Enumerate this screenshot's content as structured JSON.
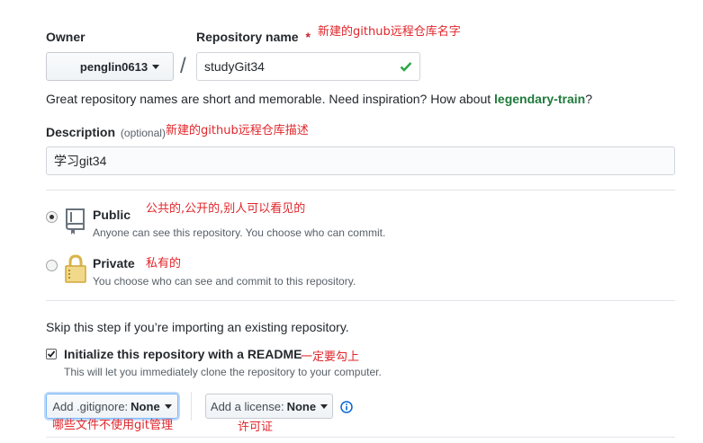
{
  "owner": {
    "label": "Owner",
    "value": "penglin0613"
  },
  "separator": "/",
  "repository": {
    "label": "Repository name",
    "required_mark": "*",
    "value": "studyGit34",
    "valid_icon": "check-icon"
  },
  "hint": {
    "text": "Great repository names are short and memorable. Need inspiration? How about",
    "suggestion": "legendary-train",
    "end": "?"
  },
  "description": {
    "label": "Description",
    "optional": "(optional)",
    "value": "学习git34"
  },
  "visibility": {
    "public": {
      "label": "Public",
      "note": "Anyone can see this repository. You choose who can commit.",
      "selected": true,
      "icon": "repo-book-icon"
    },
    "private": {
      "label": "Private",
      "note": "You choose who can see and commit to this repository.",
      "selected": false,
      "icon": "lock-icon"
    }
  },
  "import_hint": "Skip this step if you’re importing an existing repository.",
  "init": {
    "label": "Initialize this repository with a README",
    "note": "This will let you immediately clone the repository to your computer.",
    "checked": true
  },
  "gitignore": {
    "prefix": "Add .gitignore:",
    "value": "None"
  },
  "license": {
    "prefix": "Add a license:",
    "value": "None",
    "info_icon": "info-icon"
  },
  "annotations": {
    "repo_name": "新建的github远程仓库名字",
    "description": "新建的github远程仓库描述",
    "public": "公共的,公开的,别人可以看见的",
    "private": "私有的",
    "readme": "一定要勾上",
    "gitignore": "哪些文件不使用git管理",
    "license": "许可证"
  },
  "colors": {
    "accent_green": "#28a745",
    "suggestion_green": "#1f7a3a",
    "annotation_red": "#e0262b",
    "info_blue": "#0366d6",
    "focus_blue": "#79b8ff"
  }
}
